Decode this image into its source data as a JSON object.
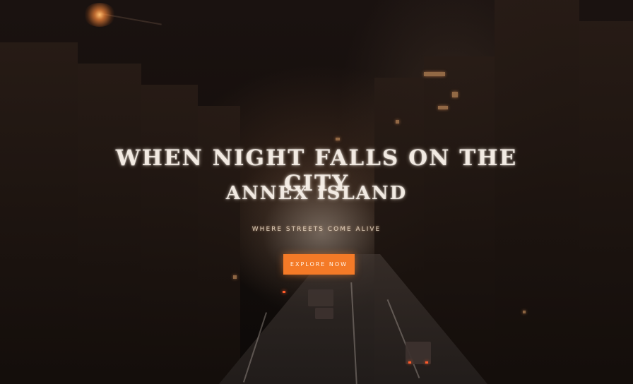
{
  "hero": {
    "headline_line1": "WHEN NIGHT FALLS ON THE CITY",
    "headline_line2": "ANNEX ISLAND",
    "subline": "WHERE STREETS COME ALIVE",
    "cta_label": "EXPLORE NOW"
  },
  "colors": {
    "cta": "#f47a27",
    "background": "#140e0b",
    "headline": "#f5eee6"
  }
}
